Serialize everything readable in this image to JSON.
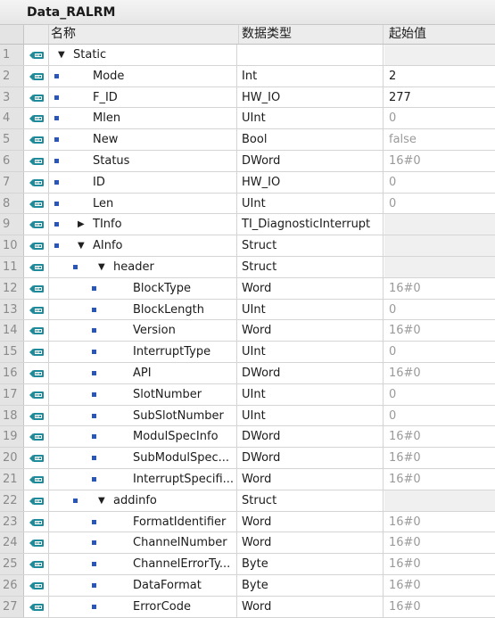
{
  "block_title": "Data_RALRM",
  "headers": {
    "name": "名称",
    "type": "数据类型",
    "init": "起始值"
  },
  "colors": {
    "bullet": "#2a56b8",
    "icon": "#1f8a9a",
    "grey_value": "#9a9a9a"
  },
  "rows": [
    {
      "num": "1",
      "name": "Static",
      "type": "",
      "init": "",
      "level": 0,
      "bullet": false,
      "expander": "down",
      "init_style": "empty"
    },
    {
      "num": "2",
      "name": "Mode",
      "type": "Int",
      "init": "2",
      "level": 1,
      "bullet": true,
      "expander": "",
      "init_style": "dark"
    },
    {
      "num": "3",
      "name": "F_ID",
      "type": "HW_IO",
      "init": "277",
      "level": 1,
      "bullet": true,
      "expander": "",
      "init_style": "dark"
    },
    {
      "num": "4",
      "name": "Mlen",
      "type": "UInt",
      "init": "0",
      "level": 1,
      "bullet": true,
      "expander": "",
      "init_style": "grey"
    },
    {
      "num": "5",
      "name": "New",
      "type": "Bool",
      "init": "false",
      "level": 1,
      "bullet": true,
      "expander": "",
      "init_style": "grey"
    },
    {
      "num": "6",
      "name": "Status",
      "type": "DWord",
      "init": "16#0",
      "level": 1,
      "bullet": true,
      "expander": "",
      "init_style": "grey"
    },
    {
      "num": "7",
      "name": "ID",
      "type": "HW_IO",
      "init": "0",
      "level": 1,
      "bullet": true,
      "expander": "",
      "init_style": "grey"
    },
    {
      "num": "8",
      "name": "Len",
      "type": "UInt",
      "init": "0",
      "level": 1,
      "bullet": true,
      "expander": "",
      "init_style": "grey"
    },
    {
      "num": "9",
      "name": "TInfo",
      "type": "TI_DiagnosticInterrupt",
      "init": "",
      "level": 1,
      "bullet": true,
      "expander": "right",
      "init_style": "empty"
    },
    {
      "num": "10",
      "name": "AInfo",
      "type": "Struct",
      "init": "",
      "level": 1,
      "bullet": true,
      "expander": "down",
      "init_style": "empty"
    },
    {
      "num": "11",
      "name": "header",
      "type": "Struct",
      "init": "",
      "level": 2,
      "bullet": true,
      "expander": "down",
      "init_style": "empty"
    },
    {
      "num": "12",
      "name": "BlockType",
      "type": "Word",
      "init": "16#0",
      "level": 3,
      "bullet": true,
      "expander": "",
      "init_style": "grey"
    },
    {
      "num": "13",
      "name": "BlockLength",
      "type": "UInt",
      "init": "0",
      "level": 3,
      "bullet": true,
      "expander": "",
      "init_style": "grey"
    },
    {
      "num": "14",
      "name": "Version",
      "type": "Word",
      "init": "16#0",
      "level": 3,
      "bullet": true,
      "expander": "",
      "init_style": "grey"
    },
    {
      "num": "15",
      "name": "InterruptType",
      "type": "UInt",
      "init": "0",
      "level": 3,
      "bullet": true,
      "expander": "",
      "init_style": "grey"
    },
    {
      "num": "16",
      "name": "API",
      "type": "DWord",
      "init": "16#0",
      "level": 3,
      "bullet": true,
      "expander": "",
      "init_style": "grey"
    },
    {
      "num": "17",
      "name": "SlotNumber",
      "type": "UInt",
      "init": "0",
      "level": 3,
      "bullet": true,
      "expander": "",
      "init_style": "grey"
    },
    {
      "num": "18",
      "name": "SubSlotNumber",
      "type": "UInt",
      "init": "0",
      "level": 3,
      "bullet": true,
      "expander": "",
      "init_style": "grey"
    },
    {
      "num": "19",
      "name": "ModulSpecInfo",
      "type": "DWord",
      "init": "16#0",
      "level": 3,
      "bullet": true,
      "expander": "",
      "init_style": "grey"
    },
    {
      "num": "20",
      "name": "SubModulSpec...",
      "type": "DWord",
      "init": "16#0",
      "level": 3,
      "bullet": true,
      "expander": "",
      "init_style": "grey"
    },
    {
      "num": "21",
      "name": "InterruptSpecifi...",
      "type": "Word",
      "init": "16#0",
      "level": 3,
      "bullet": true,
      "expander": "",
      "init_style": "grey"
    },
    {
      "num": "22",
      "name": "addinfo",
      "type": "Struct",
      "init": "",
      "level": 2,
      "bullet": true,
      "expander": "down",
      "init_style": "empty"
    },
    {
      "num": "23",
      "name": "FormatIdentifier",
      "type": "Word",
      "init": "16#0",
      "level": 3,
      "bullet": true,
      "expander": "",
      "init_style": "grey"
    },
    {
      "num": "24",
      "name": "ChannelNumber",
      "type": "Word",
      "init": "16#0",
      "level": 3,
      "bullet": true,
      "expander": "",
      "init_style": "grey"
    },
    {
      "num": "25",
      "name": "ChannelErrorTy...",
      "type": "Byte",
      "init": "16#0",
      "level": 3,
      "bullet": true,
      "expander": "",
      "init_style": "grey"
    },
    {
      "num": "26",
      "name": "DataFormat",
      "type": "Byte",
      "init": "16#0",
      "level": 3,
      "bullet": true,
      "expander": "",
      "init_style": "grey"
    },
    {
      "num": "27",
      "name": "ErrorCode",
      "type": "Word",
      "init": "16#0",
      "level": 3,
      "bullet": true,
      "expander": "",
      "init_style": "grey"
    }
  ]
}
